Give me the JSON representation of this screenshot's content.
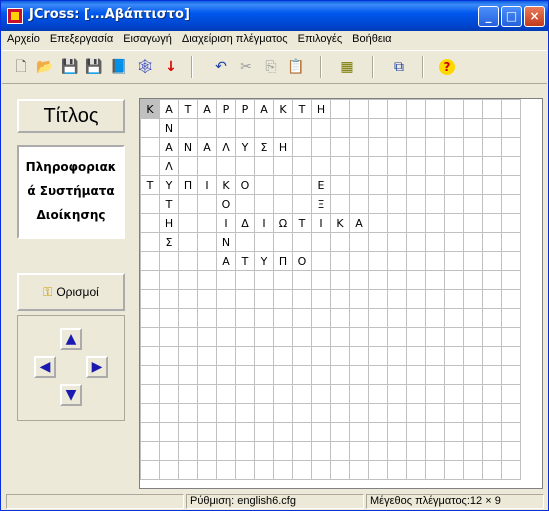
{
  "window": {
    "title": "JCross: [...Αβάπτιστο]",
    "min": "_",
    "max": "□",
    "close": "×"
  },
  "menu": [
    "Αρχείο",
    "Επεξεργασία",
    "Εισαγωγή",
    "Διαχείριση πλέγματος",
    "Επιλογές",
    "Βοήθεια"
  ],
  "toolbar": {
    "new": "🗋",
    "open": "📂",
    "save": "💾",
    "saveas": "💾",
    "web": "📘",
    "network": "🕸",
    "down": "↓",
    "undo": "↶",
    "cut": "✂",
    "copy": "⎘",
    "paste": "📋",
    "grid": "▦",
    "export": "⧉",
    "help": "?"
  },
  "left": {
    "title_btn": "Τίτλος",
    "desc_line1": "Πληροφοριακ",
    "desc_line2": "ά Συστήματα",
    "desc_line3": "Διοίκησης",
    "defs_btn": "Ορισμοί",
    "arrows": {
      "up": "▲",
      "left": "◀",
      "right": "▶",
      "down": "▼"
    }
  },
  "grid": {
    "rows": 20,
    "cols": 20,
    "selected": [
      0,
      0
    ],
    "letters": [
      [
        "Κ",
        "Α",
        "Τ",
        "Α",
        "Ρ",
        "Ρ",
        "Α",
        "Κ",
        "Τ",
        "Η"
      ],
      [
        "",
        "Ν"
      ],
      [
        "",
        "Α",
        "Ν",
        "Α",
        "Λ",
        "Υ",
        "Σ",
        "Η"
      ],
      [
        "",
        "Λ"
      ],
      [
        "Τ",
        "Υ",
        "Π",
        "Ι",
        "Κ",
        "Ο",
        "",
        "",
        "",
        "Ε"
      ],
      [
        "",
        "Τ",
        "",
        "",
        "Ο",
        "",
        "",
        "",
        "",
        "Ξ"
      ],
      [
        "",
        "Η",
        "",
        "",
        "Ι",
        "Δ",
        "Ι",
        "Ω",
        "Τ",
        "Ι",
        "Κ",
        "Α"
      ],
      [
        "",
        "Σ",
        "",
        "",
        "Ν"
      ],
      [
        "",
        "",
        "",
        "",
        "Α",
        "Τ",
        "Υ",
        "Π",
        "Ο"
      ]
    ]
  },
  "status": {
    "config": "Ρύθμιση: english6.cfg",
    "size": "Μέγεθος πλέγματος:12 × 9"
  }
}
